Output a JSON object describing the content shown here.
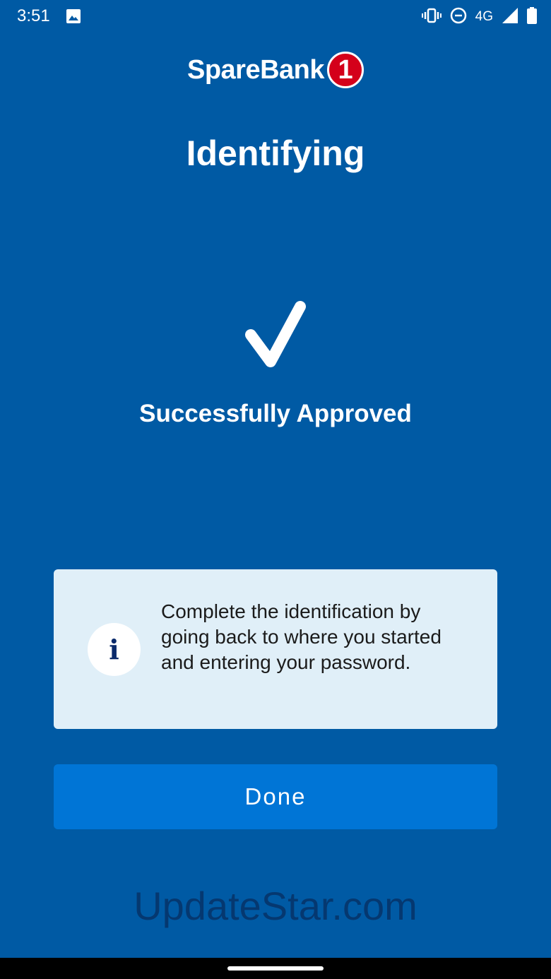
{
  "status_bar": {
    "time": "3:51",
    "network": "4G",
    "icons": [
      "gallery-icon",
      "vibrate-icon",
      "do-not-disturb-icon",
      "signal-icon",
      "battery-icon"
    ]
  },
  "brand": {
    "name": "SpareBank",
    "badge": "1",
    "badge_color": "#d4001a"
  },
  "page": {
    "title": "Identifying",
    "status_icon": "checkmark-icon",
    "status_text": "Successfully Approved"
  },
  "info_card": {
    "icon": "info-icon",
    "icon_glyph": "i",
    "message": "Complete the identification by going back to where you started and entering your password."
  },
  "actions": {
    "done_label": "Done"
  },
  "watermark": "UpdateStar.com",
  "colors": {
    "background": "#005aa4",
    "button": "#0075d6",
    "card": "#e0eff8"
  }
}
